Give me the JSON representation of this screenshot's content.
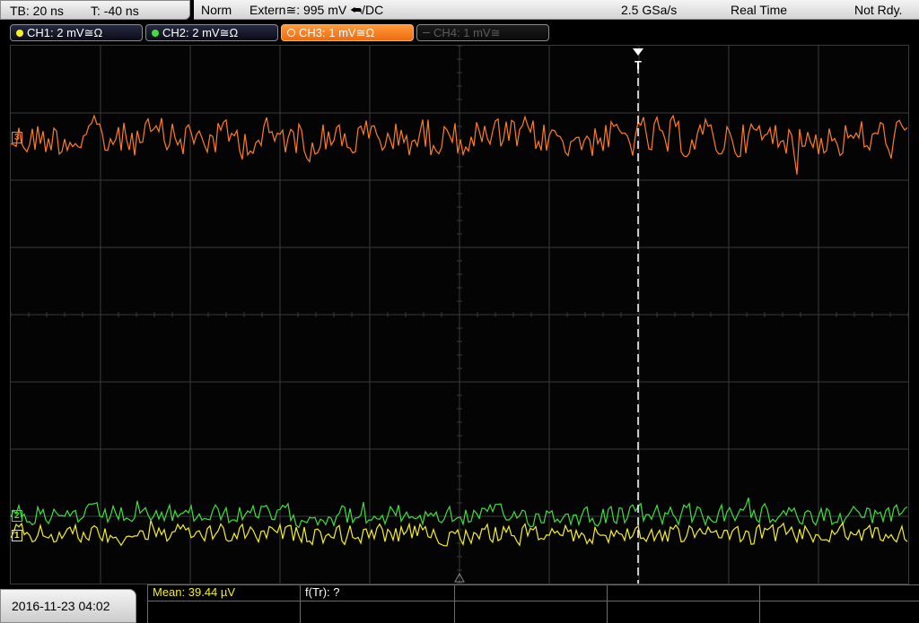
{
  "timebase": {
    "tb": "TB: 20 ns",
    "trigger_pos": "T: -40 ns"
  },
  "status": {
    "mode": "Norm",
    "trigger": "Extern≅: 995 mV ⮪/DC",
    "sample_rate": "2.5 GSa/s",
    "acq_mode": "Real Time",
    "state": "Not Rdy."
  },
  "channels": [
    {
      "label": "CH1: 2 mV≅Ω",
      "color": "#f5f020",
      "state": "on"
    },
    {
      "label": "CH2: 2 mV≅Ω",
      "color": "#3ee03e",
      "state": "on"
    },
    {
      "label": "CH3: 1 mV≅Ω",
      "color": "#ff7d1e",
      "state": "selected"
    },
    {
      "label": "CH4: 1 mV≅",
      "color": "#6a6a6a",
      "state": "off"
    }
  ],
  "markers": {
    "ch3": "3",
    "ch2": "2",
    "ch1": "1",
    "trigger": "T"
  },
  "bottom": {
    "datetime": "2016-11-23 04:02",
    "measurements": [
      {
        "label": "Mean: 39.44 µV",
        "color": "#f5f020"
      },
      {
        "label": "f(Tr): ?",
        "color": "#ffffff"
      }
    ]
  },
  "colors": {
    "grid": "#3a3a3a",
    "ch1": "#f5f020",
    "ch2": "#3ee03e",
    "ch3": "#ff7d1e",
    "trigger_line": "#ffffff"
  }
}
